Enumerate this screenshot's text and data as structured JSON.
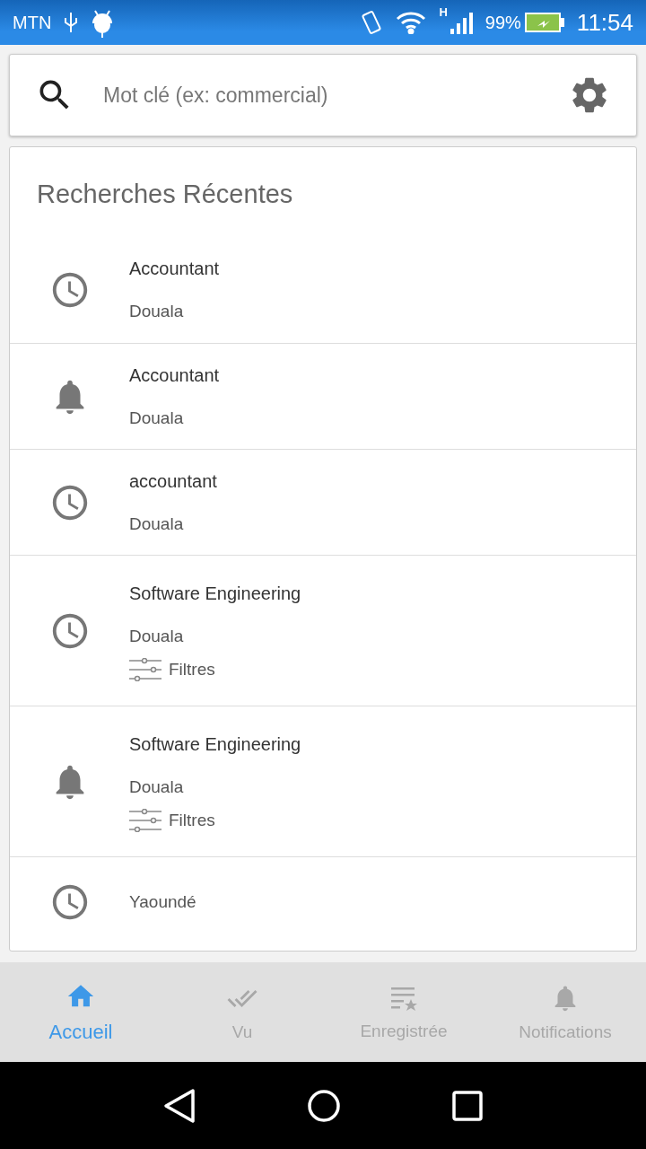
{
  "status_bar": {
    "carrier": "MTN",
    "network": "H",
    "battery": "99%",
    "time": "11:54"
  },
  "search": {
    "placeholder": "Mot clé (ex: commercial)"
  },
  "recent": {
    "title": "Recherches Récentes",
    "items": [
      {
        "kind": "history",
        "title": "Accountant",
        "location": "Douala"
      },
      {
        "kind": "alert",
        "title": "Accountant",
        "location": "Douala"
      },
      {
        "kind": "history",
        "title": "accountant",
        "location": "Douala"
      },
      {
        "kind": "history",
        "title": "Software Engineering",
        "location": "Douala",
        "filters": "Filtres"
      },
      {
        "kind": "alert",
        "title": "Software Engineering",
        "location": "Douala",
        "filters": "Filtres"
      },
      {
        "kind": "history",
        "location": "Yaoundé"
      }
    ]
  },
  "bottom_nav": [
    {
      "kind": "home",
      "label": "Accueil",
      "selected": true
    },
    {
      "kind": "seen",
      "label": "Vu",
      "selected": false
    },
    {
      "kind": "saved",
      "label": "Enregistrée",
      "selected": false
    },
    {
      "kind": "notifications",
      "label": "Notifications",
      "selected": false
    }
  ]
}
